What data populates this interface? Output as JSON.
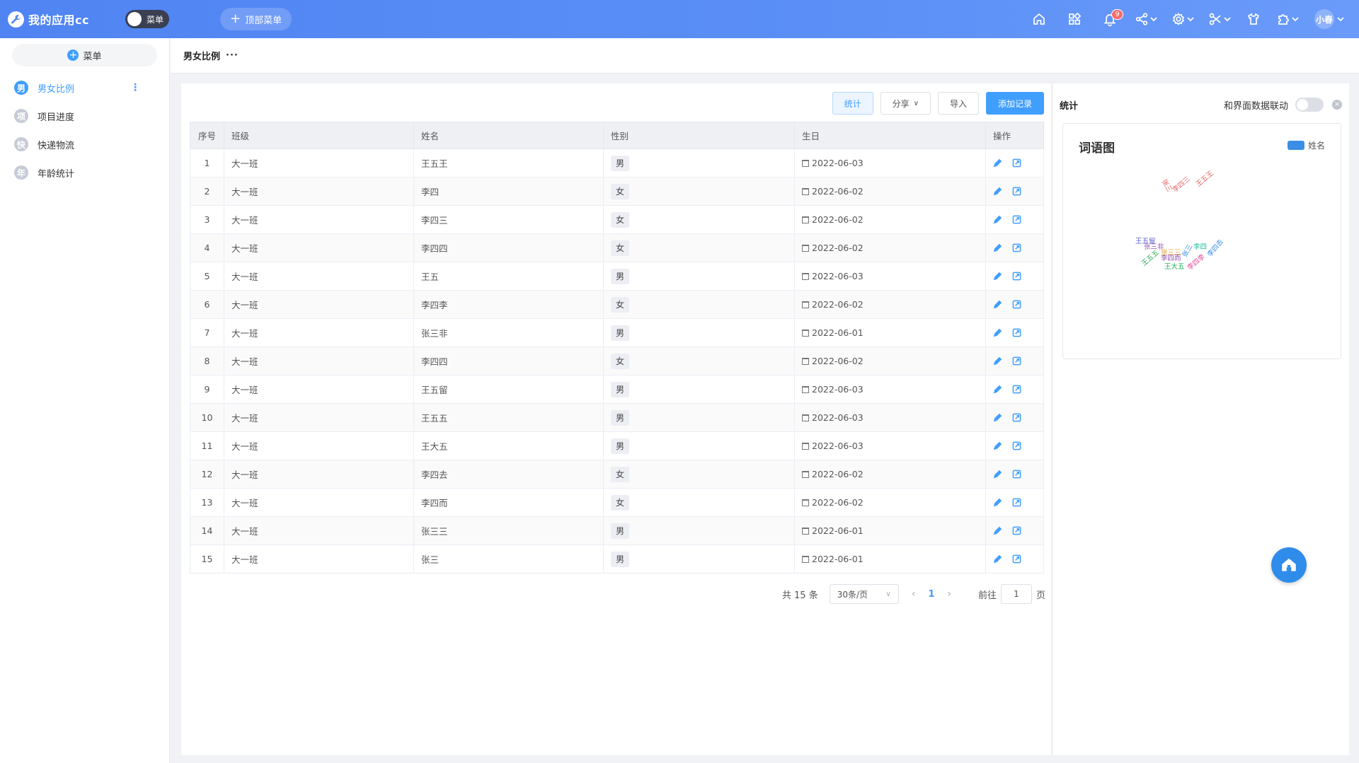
{
  "app": {
    "title": "我的应用cc",
    "menu_toggle_label": "菜单",
    "top_menu_label": "顶部菜单",
    "notification_count": "9",
    "user_name": "小春"
  },
  "sidebar": {
    "menu_button": "菜单",
    "items": [
      {
        "avatar": "男",
        "label": "男女比例",
        "active": true
      },
      {
        "avatar": "项",
        "label": "项目进度"
      },
      {
        "avatar": "快",
        "label": "快递物流"
      },
      {
        "avatar": "年",
        "label": "年龄统计"
      }
    ]
  },
  "breadcrumb": {
    "title": "男女比例",
    "more": "···"
  },
  "toolbar": {
    "stats": "统计",
    "share": "分享",
    "import": "导入",
    "add": "添加记录"
  },
  "table": {
    "headers": [
      "序号",
      "班级",
      "姓名",
      "性别",
      "生日",
      "操作"
    ],
    "rows": [
      [
        "1",
        "大一班",
        "王五王",
        "男",
        "2022-06-03"
      ],
      [
        "2",
        "大一班",
        "李四",
        "女",
        "2022-06-02"
      ],
      [
        "3",
        "大一班",
        "李四三",
        "女",
        "2022-06-02"
      ],
      [
        "4",
        "大一班",
        "李四四",
        "女",
        "2022-06-02"
      ],
      [
        "5",
        "大一班",
        "王五",
        "男",
        "2022-06-03"
      ],
      [
        "6",
        "大一班",
        "李四李",
        "女",
        "2022-06-02"
      ],
      [
        "7",
        "大一班",
        "张三非",
        "男",
        "2022-06-01"
      ],
      [
        "8",
        "大一班",
        "李四四",
        "女",
        "2022-06-02"
      ],
      [
        "9",
        "大一班",
        "王五留",
        "男",
        "2022-06-03"
      ],
      [
        "10",
        "大一班",
        "王五五",
        "男",
        "2022-06-03"
      ],
      [
        "11",
        "大一班",
        "王大五",
        "男",
        "2022-06-03"
      ],
      [
        "12",
        "大一班",
        "李四去",
        "女",
        "2022-06-02"
      ],
      [
        "13",
        "大一班",
        "李四而",
        "女",
        "2022-06-02"
      ],
      [
        "14",
        "大一班",
        "张三三",
        "男",
        "2022-06-01"
      ],
      [
        "15",
        "大一班",
        "张三",
        "男",
        "2022-06-01"
      ]
    ]
  },
  "pager": {
    "total": "共 15 条",
    "page_size": "30条/页",
    "current": "1",
    "goto_label": "前往",
    "goto_value": "1",
    "page_suffix": "页"
  },
  "stats": {
    "title": "统计",
    "link_label": "和界面数据联动",
    "chart_title": "词语图",
    "legend": "姓名",
    "words": [
      {
        "text": "张三",
        "color": "#e06666"
      },
      {
        "text": "李四三",
        "color": "#e06666"
      },
      {
        "text": "王五王",
        "color": "#e06666"
      },
      {
        "text": "王五留",
        "color": "#5b5fc7"
      },
      {
        "text": "张三非",
        "color": "#9b59b6"
      },
      {
        "text": "王五五",
        "color": "#2eaa5b"
      },
      {
        "text": "张三三",
        "color": "#e6a23c"
      },
      {
        "text": "李四而",
        "color": "#8e44ad"
      },
      {
        "text": "张三",
        "color": "#3a8ee6"
      },
      {
        "text": "李四",
        "color": "#1abc9c"
      },
      {
        "text": "李四去",
        "color": "#3a8ee6"
      },
      {
        "text": "李四李",
        "color": "#e84393"
      },
      {
        "text": "王大五",
        "color": "#27ae60"
      }
    ]
  },
  "colors": {
    "primary": "#409eff",
    "topbar": "#5b8ff7"
  }
}
